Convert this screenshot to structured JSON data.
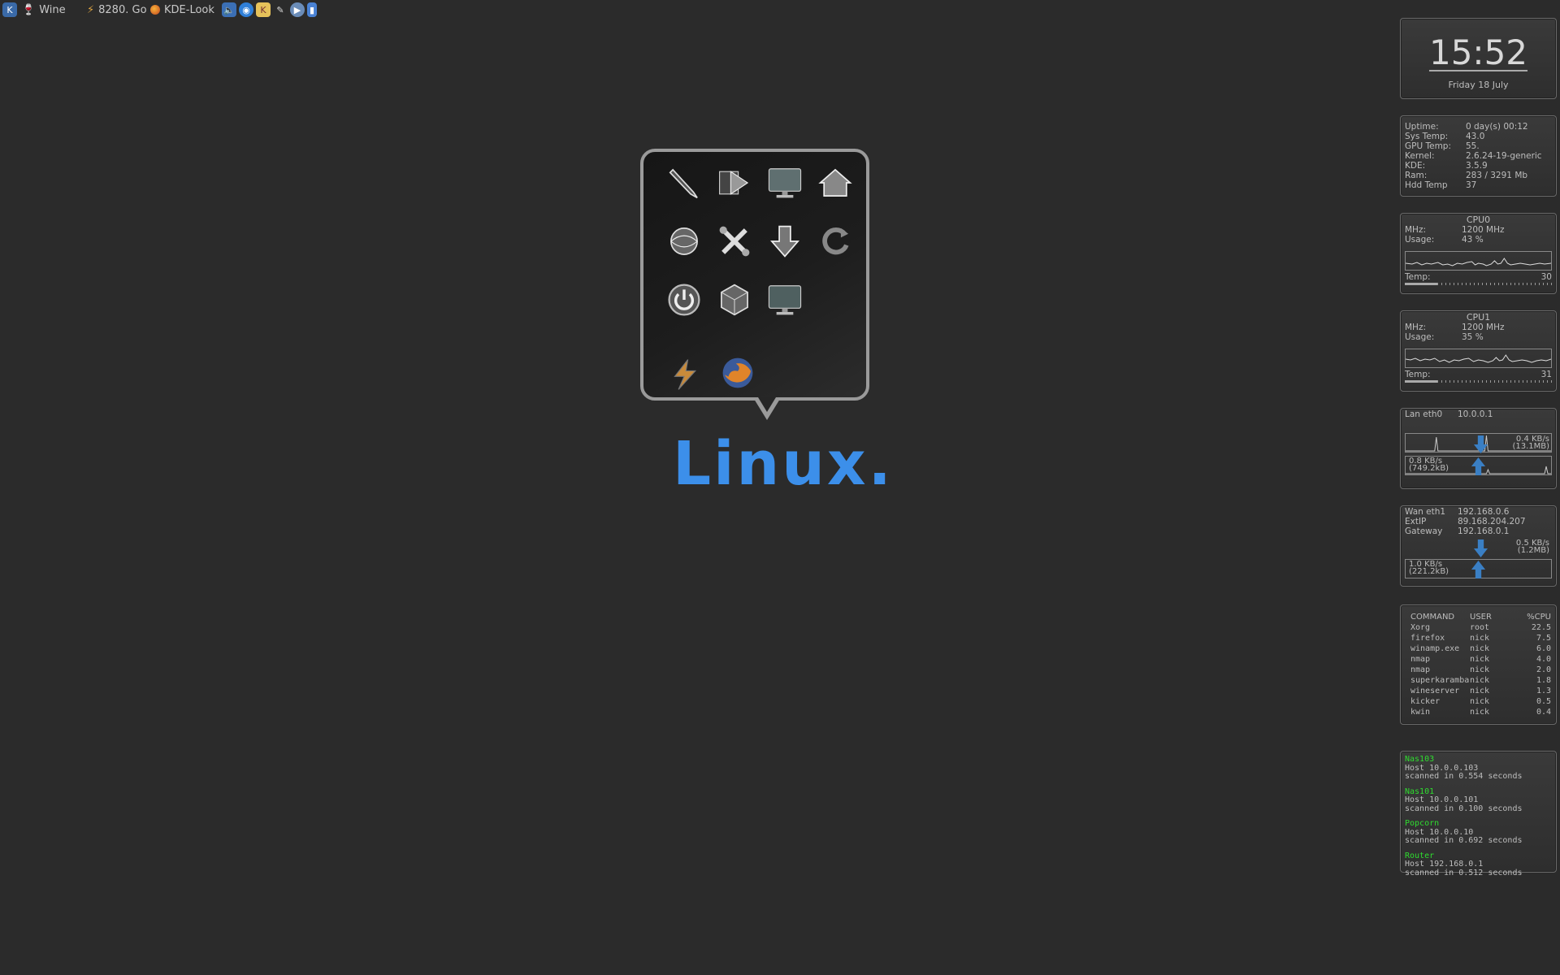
{
  "taskbar": {
    "tasks": [
      {
        "label": "Wine",
        "icon": "wine-glass-icon"
      },
      {
        "label": "8280. Go",
        "icon": "winamp-bolt-icon"
      },
      {
        "label": "KDE-Look",
        "icon": "firefox-icon"
      }
    ],
    "tray_icons": [
      "speaker-icon",
      "network-icon",
      "klipper-icon",
      "power-plug-icon",
      "media-player-icon",
      "device-icon"
    ]
  },
  "launcher": {
    "icons": [
      "pen-icon",
      "media-icon",
      "monitor-icon",
      "home-icon",
      "internet-icon",
      "tools-icon",
      "download-icon",
      "refresh-icon",
      "power-icon",
      "package-icon",
      "display-icon",
      "winamp-icon",
      "firefox-icon"
    ]
  },
  "brand": {
    "text": "Linux.",
    "color": "#3c8fea"
  },
  "clock": {
    "time": "15:52",
    "date": "Friday 18 July"
  },
  "sysinfo": [
    {
      "k": "Uptime:",
      "v": "0 day(s) 00:12"
    },
    {
      "k": "Sys Temp:",
      "v": "43.0"
    },
    {
      "k": "GPU Temp:",
      "v": "55."
    },
    {
      "k": "Kernel:",
      "v": "2.6.24-19-generic"
    },
    {
      "k": "KDE:",
      "v": "3.5.9"
    },
    {
      "k": "Ram:",
      "v": "283 / 3291 Mb"
    },
    {
      "k": "Hdd Temp",
      "v": "37"
    }
  ],
  "cpus": [
    {
      "title": "CPU0",
      "mhz_label": "MHz:",
      "mhz": "1200 MHz",
      "usage_label": "Usage:",
      "usage": "43 %",
      "temp_label": "Temp:",
      "temp": "30",
      "temp_fill": 0.22
    },
    {
      "title": "CPU1",
      "mhz_label": "MHz:",
      "mhz": "1200 MHz",
      "usage_label": "Usage:",
      "usage": "35 %",
      "temp_label": "Temp:",
      "temp": "31",
      "temp_fill": 0.22
    }
  ],
  "lan": {
    "label": "Lan eth0",
    "ip": "10.0.0.1",
    "down_rate": "0.4 KB/s",
    "down_total": "(13.1MB)",
    "up_rate": "0.8 KB/s",
    "up_total": "(749.2kB)"
  },
  "wan": {
    "label": "Wan eth1",
    "ip": "192.168.0.6",
    "extip_label": "ExtIP",
    "extip": "89.168.204.207",
    "gw_label": "Gateway",
    "gw": "192.168.0.1",
    "down_rate": "0.5 KB/s",
    "down_total": "(1.2MB)",
    "up_rate": "1.0 KB/s",
    "up_total": "(221.2kB)"
  },
  "processes": {
    "headers": [
      "COMMAND",
      "USER",
      "%CPU"
    ],
    "rows": [
      [
        "Xorg",
        "root",
        "22.5"
      ],
      [
        "firefox",
        "nick",
        "7.5"
      ],
      [
        "winamp.exe",
        "nick",
        "6.0"
      ],
      [
        "nmap",
        "nick",
        "4.0"
      ],
      [
        "nmap",
        "nick",
        "2.0"
      ],
      [
        "superkaramba",
        "nick",
        "1.8"
      ],
      [
        "wineserver",
        "nick",
        "1.3"
      ],
      [
        "kicker",
        "nick",
        "0.5"
      ],
      [
        "kwin",
        "nick",
        "0.4"
      ]
    ]
  },
  "nmap_hosts": [
    {
      "name": "Nas103",
      "host": "Host 10.0.0.103",
      "scan": "scanned in 0.554 seconds"
    },
    {
      "name": "Nas101",
      "host": "Host 10.0.0.101",
      "scan": "scanned in 0.100 seconds"
    },
    {
      "name": "Popcorn",
      "host": "Host 10.0.0.10",
      "scan": "scanned in 0.692 seconds"
    },
    {
      "name": "Router",
      "host": "Host 192.168.0.1",
      "scan": "scanned in 0.512 seconds"
    }
  ]
}
